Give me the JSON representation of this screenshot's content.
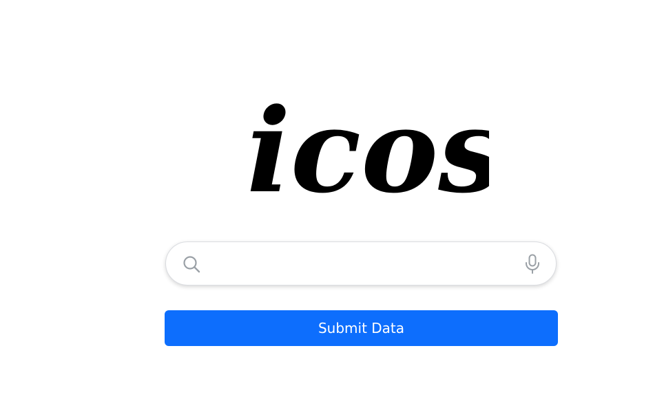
{
  "logo": {
    "text": "icos"
  },
  "search": {
    "value": "",
    "placeholder": ""
  },
  "icons": {
    "search": "search-icon",
    "mic": "microphone-icon"
  },
  "submit": {
    "label": "Submit Data"
  },
  "colors": {
    "button_bg": "#0d6efd",
    "button_text": "#ffffff",
    "icon": "#9aa0a6",
    "search_border": "#dadce0",
    "logo": "#000000"
  }
}
